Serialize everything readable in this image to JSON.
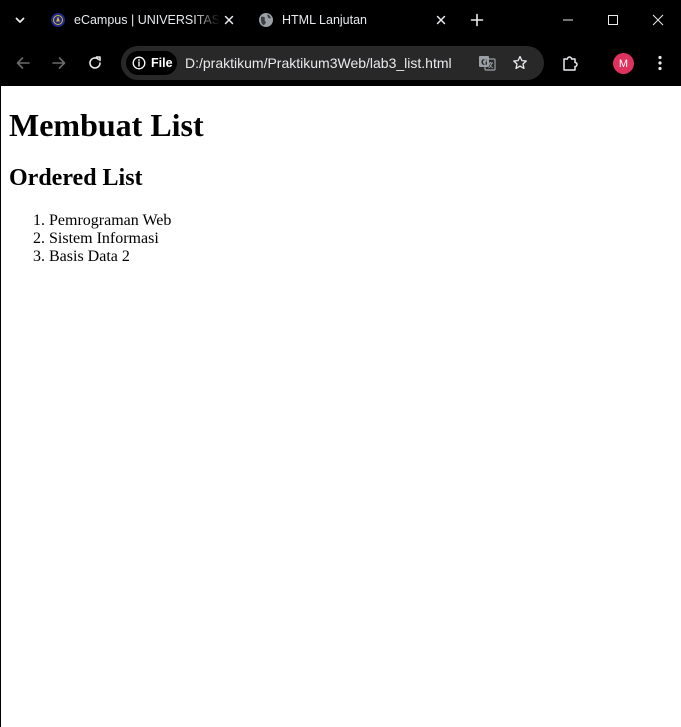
{
  "browser": {
    "tabs": [
      {
        "title": "eCampus | UNIVERSITAS PGRI",
        "favicon": "university-logo-icon",
        "active": false
      },
      {
        "title": "HTML Lanjutan",
        "favicon": "globe-icon",
        "active": true
      }
    ],
    "security_chip_label": "File",
    "url": "D:/praktikum/Praktikum3Web/lab3_list.html",
    "profile_initial": "M",
    "colors": {
      "chrome_bg": "#000000",
      "omnibox_bg": "#282828",
      "avatar_bg": "#e0325f",
      "text": "#e8eaed"
    }
  },
  "page": {
    "heading": "Membuat List",
    "subheading": "Ordered List",
    "ordered_list": [
      "Pemrograman Web",
      "Sistem Informasi",
      "Basis Data 2"
    ]
  }
}
